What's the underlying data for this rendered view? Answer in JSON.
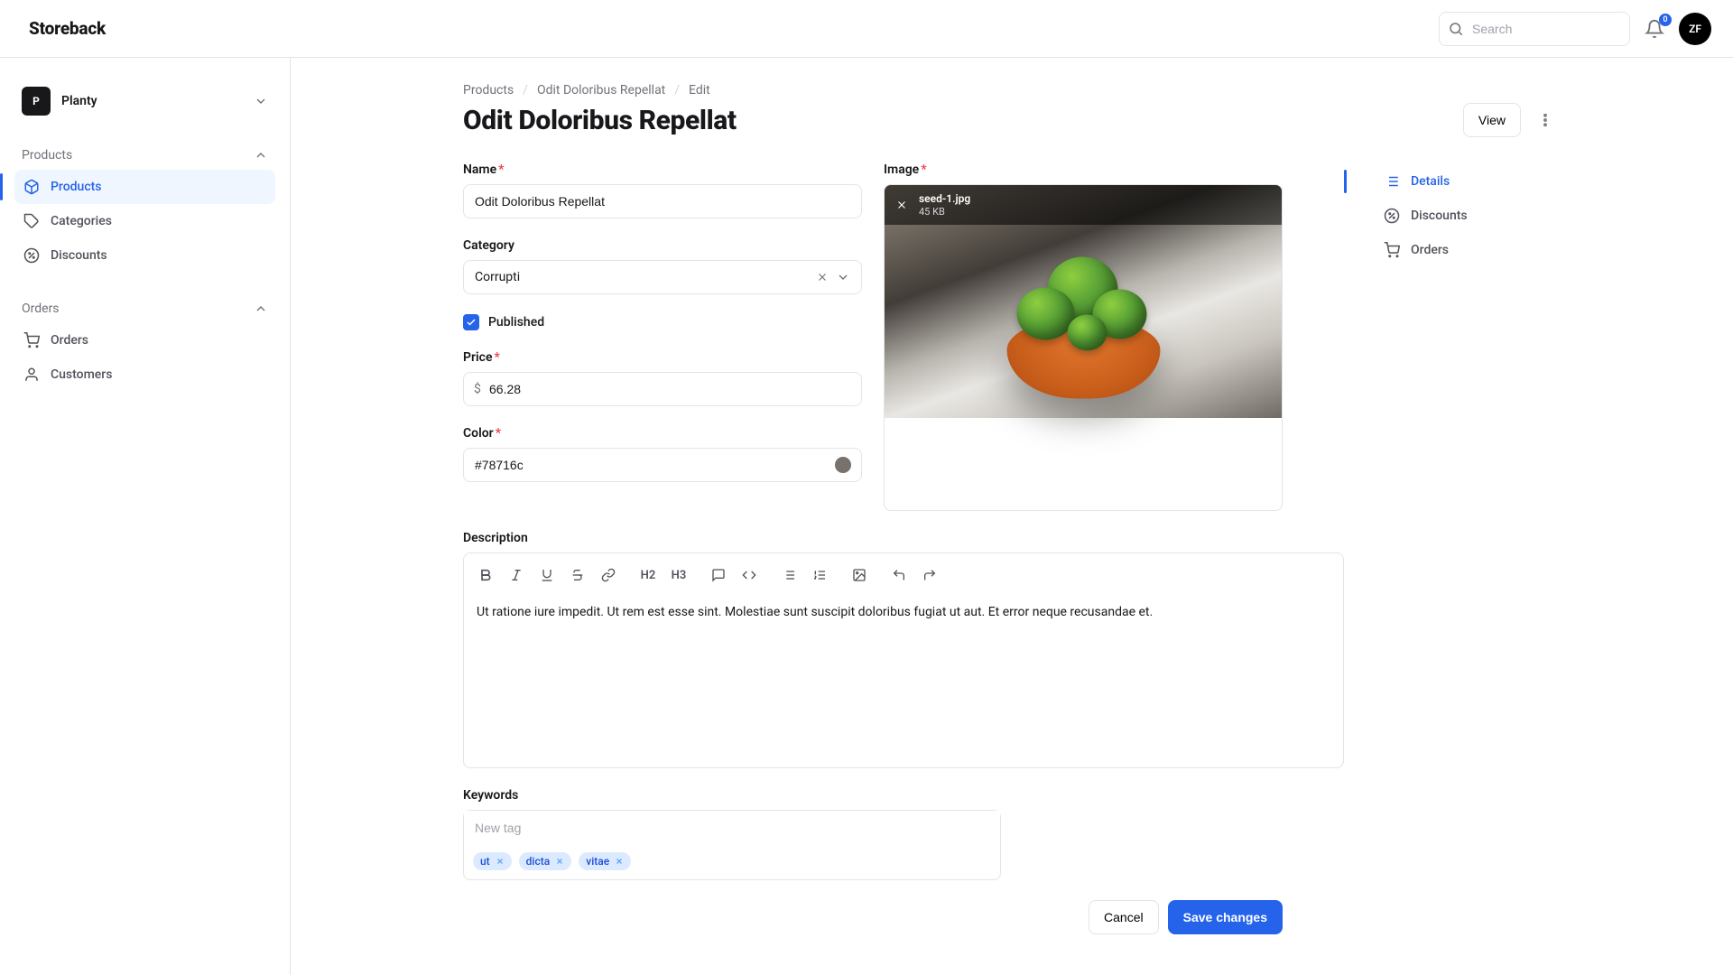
{
  "brand": "Storeback",
  "search": {
    "placeholder": "Search"
  },
  "notifications": {
    "count": "0"
  },
  "user": {
    "initials": "ZF"
  },
  "tenant": {
    "badge": "P",
    "name": "Planty"
  },
  "sidebar": {
    "section1": {
      "label": "Products"
    },
    "items1": [
      {
        "label": "Products"
      },
      {
        "label": "Categories"
      },
      {
        "label": "Discounts"
      }
    ],
    "section2": {
      "label": "Orders"
    },
    "items2": [
      {
        "label": "Orders"
      },
      {
        "label": "Customers"
      }
    ]
  },
  "breadcrumb": {
    "a": "Products",
    "b": "Odit Doloribus Repellat",
    "c": "Edit"
  },
  "page": {
    "title": "Odit Doloribus Repellat",
    "view": "View"
  },
  "form": {
    "name_label": "Name",
    "name_value": "Odit Doloribus Repellat",
    "category_label": "Category",
    "category_value": "Corrupti",
    "published_label": "Published",
    "price_label": "Price",
    "price_symbol": "$",
    "price_value": "66.28",
    "color_label": "Color",
    "color_value": "#78716c",
    "image_label": "Image",
    "image_name": "seed-1.jpg",
    "image_size": "45 KB",
    "description_label": "Description",
    "description_text": "Ut ratione iure impedit. Ut rem est esse sint. Molestiae sunt suscipit doloribus fugiat ut aut. Et error neque recusandae et.",
    "keywords_label": "Keywords",
    "keywords_placeholder": "New tag",
    "tags": [
      "ut",
      "dicta",
      "vitae"
    ],
    "cancel": "Cancel",
    "save": "Save changes"
  },
  "sidenav": {
    "items": [
      {
        "label": "Details"
      },
      {
        "label": "Discounts"
      },
      {
        "label": "Orders"
      }
    ]
  },
  "toolbar": {
    "h2": "H2",
    "h3": "H3"
  },
  "colors": {
    "swatch": "#78716c"
  }
}
